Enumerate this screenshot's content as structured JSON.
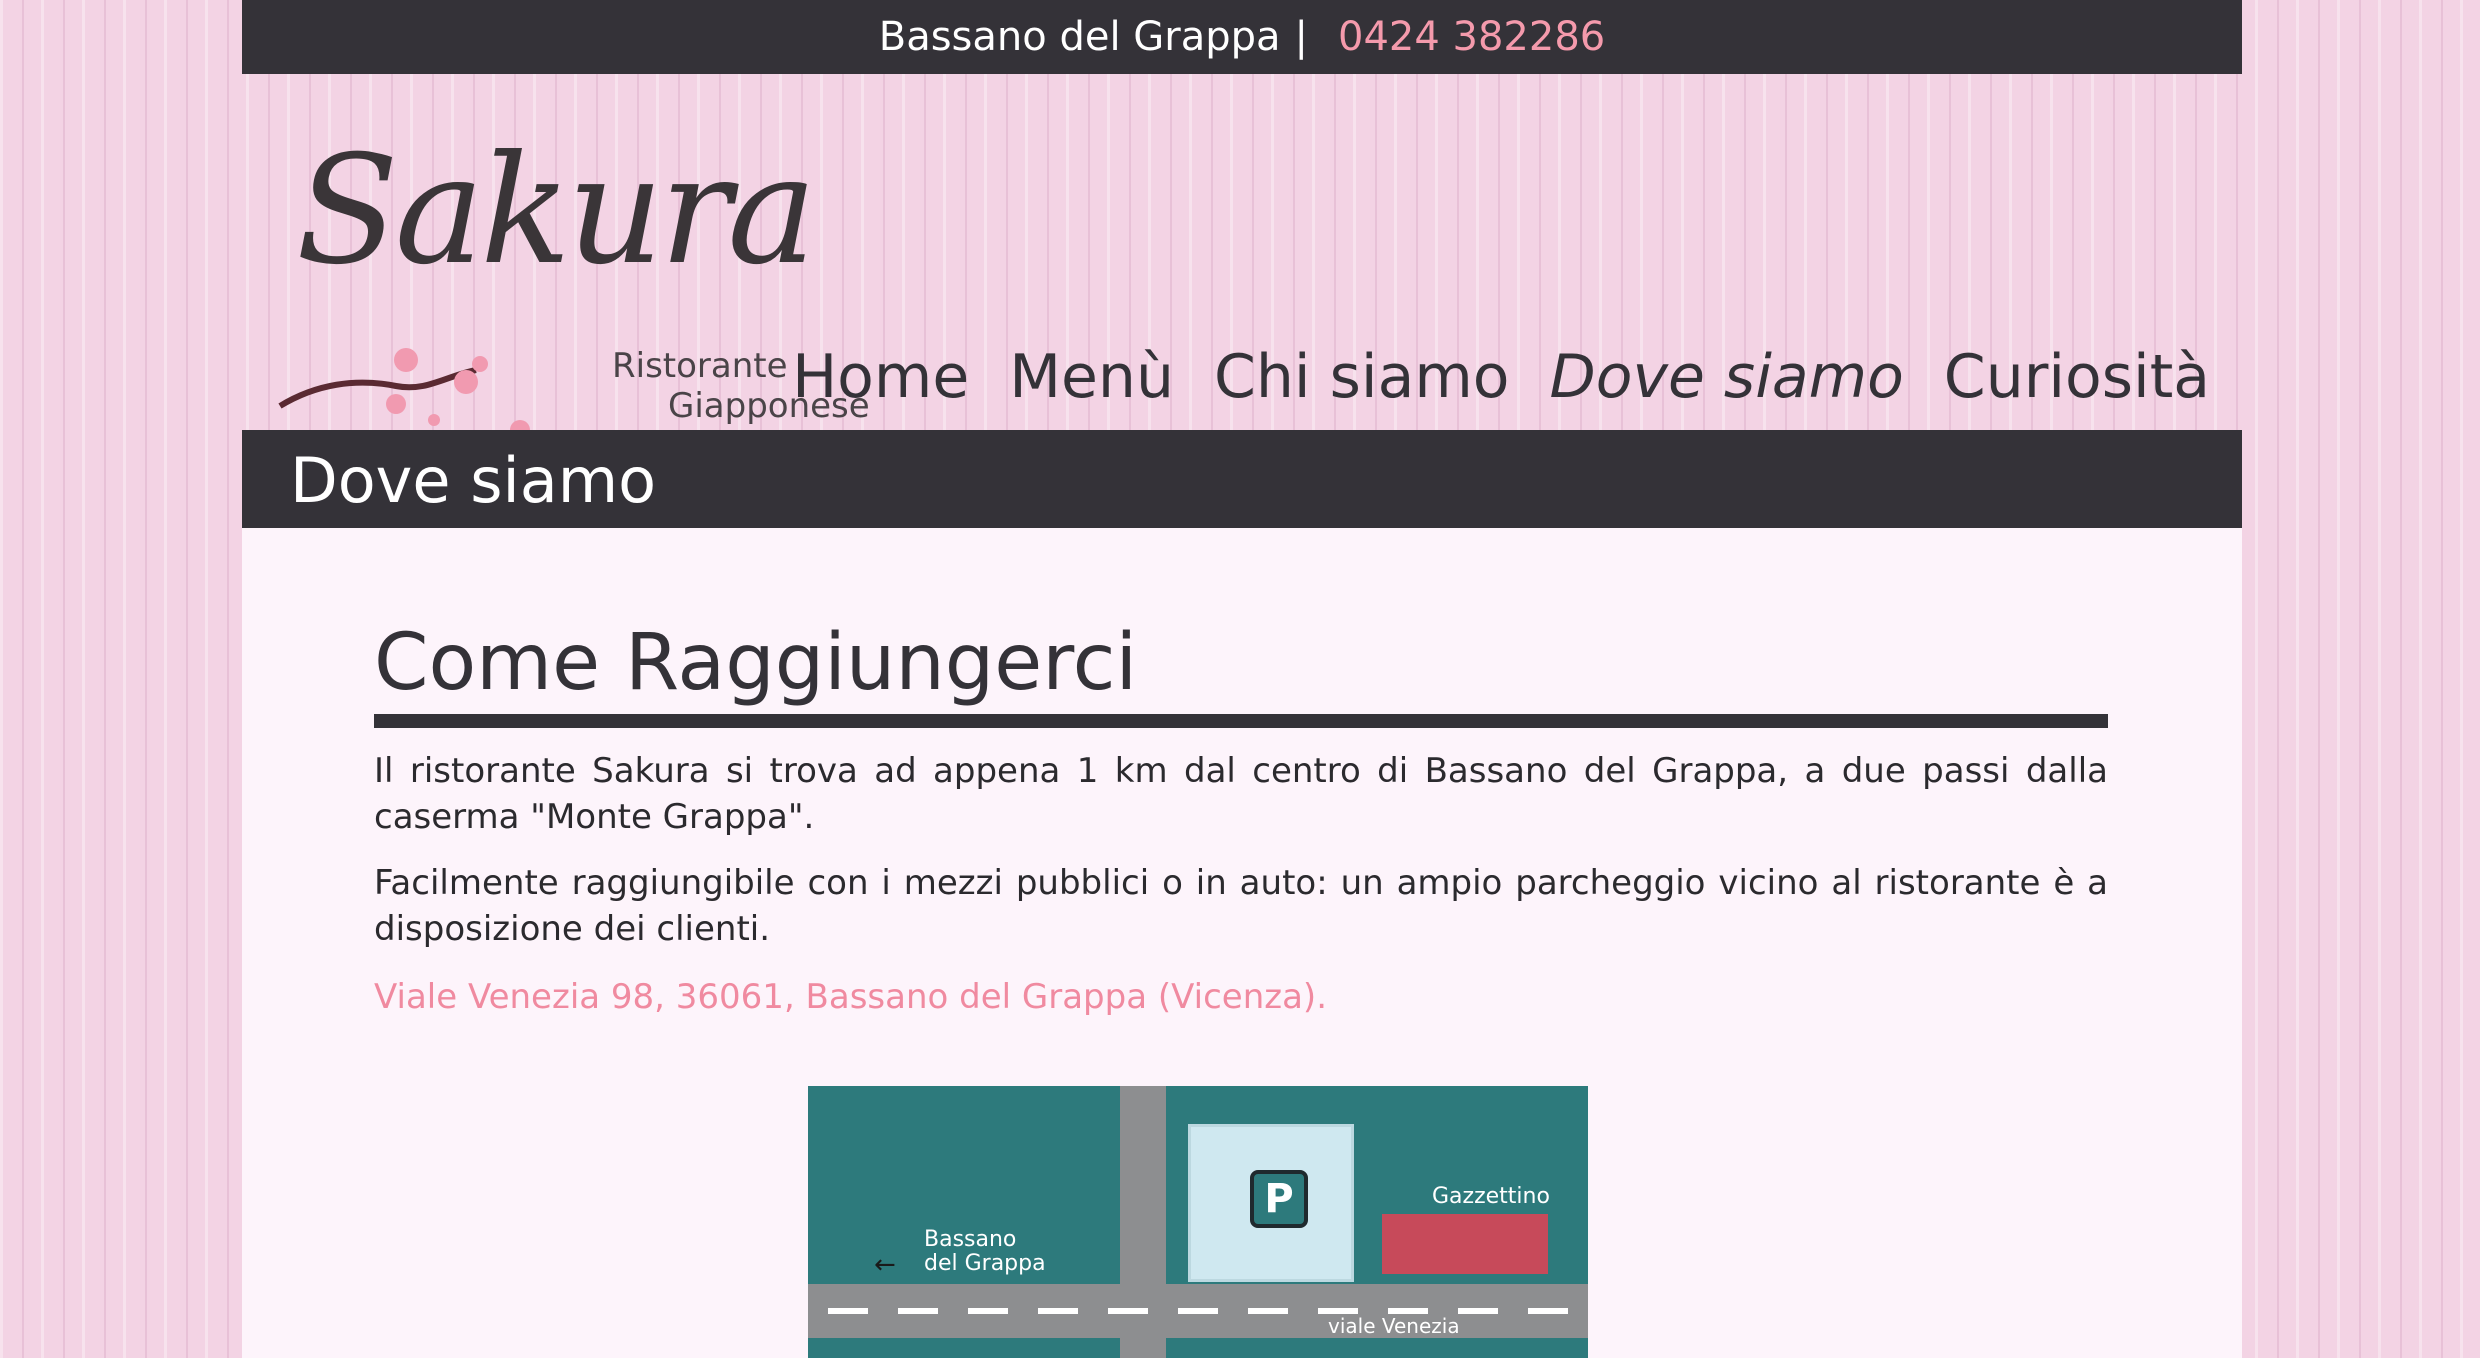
{
  "topbar": {
    "city": "Bassano del Grappa",
    "separator": "|",
    "phone": "0424 382286"
  },
  "logo": {
    "name": "Sakura",
    "subtitle_line1": "Ristorante",
    "subtitle_line2": "Giapponese"
  },
  "nav": {
    "items": [
      {
        "label": "Home"
      },
      {
        "label": "Menù"
      },
      {
        "label": "Chi siamo"
      },
      {
        "label": "Dove siamo",
        "active": true
      },
      {
        "label": "Curiosità"
      }
    ]
  },
  "page_title": "Dove siamo",
  "section": {
    "heading": "Come Raggiungerci",
    "paragraph1": "Il ristorante Sakura si trova ad appena 1 km dal centro di Bassano del Grappa, a due passi dalla caserma \"Monte Grappa\".",
    "paragraph2": "Facilmente raggiungibile con i mezzi pubblici o in auto: un ampio parcheggio vicino al ristorante è a disposizione dei clienti.",
    "address": "Viale Venezia 98, 36061, Bassano del Grappa (Vicenza)."
  },
  "map": {
    "parking_label": "P",
    "gazzettino_label": "Gazzettino",
    "bassano_label_line1": "Bassano",
    "bassano_label_line2": "del Grappa",
    "street_label": "viale Venezia"
  },
  "colors": {
    "dark": "#343238",
    "accent_pink": "#f49aac",
    "content_bg": "#fdf4fb"
  }
}
